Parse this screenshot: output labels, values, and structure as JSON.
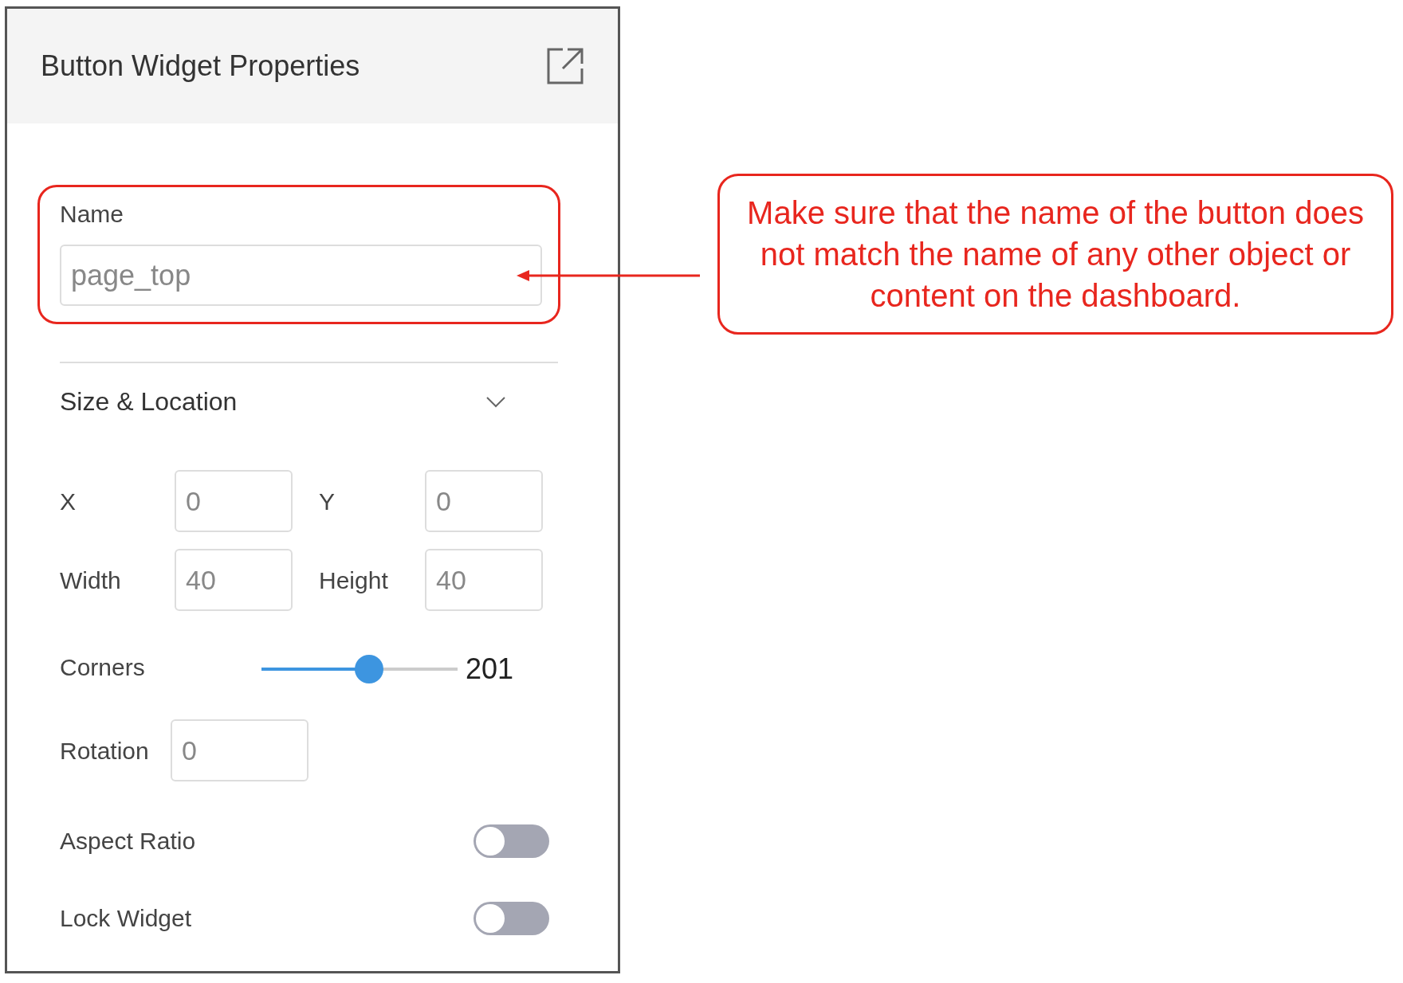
{
  "panel": {
    "title": "Button Widget Properties"
  },
  "name_field": {
    "label": "Name",
    "value": "page_top"
  },
  "section": {
    "title": "Size & Location",
    "expanded": true
  },
  "fields": [
    {
      "label": "X",
      "value": "0"
    },
    {
      "label": "Y",
      "value": "0"
    },
    {
      "label": "Width",
      "value": "40"
    },
    {
      "label": "Height",
      "value": "40"
    }
  ],
  "corners": {
    "label": "Corners",
    "level": 0.55,
    "reading": "201"
  },
  "rotation": {
    "label": "Rotation",
    "value": "0"
  },
  "toggles": [
    {
      "label": "Aspect Ratio",
      "on": false
    },
    {
      "label": "Lock Widget",
      "on": false
    }
  ],
  "callout": {
    "text": "Make sure that the name of the button does not match the name of any other object or content on the dashboard."
  }
}
